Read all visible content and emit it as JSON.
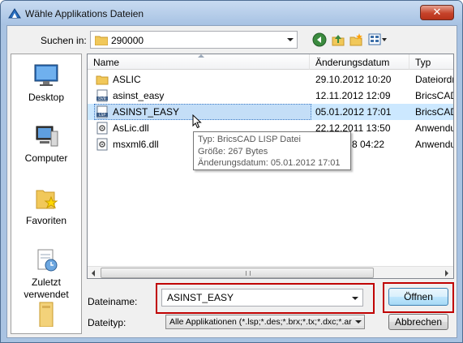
{
  "window": {
    "title": "Wähle Applikations Dateien",
    "close_label": "✕"
  },
  "lookin": {
    "label": "Suchen in:",
    "value": "290000"
  },
  "places": [
    {
      "label": "Desktop",
      "icon": "desktop-icon"
    },
    {
      "label": "Computer",
      "icon": "computer-icon"
    },
    {
      "label": "Favoriten",
      "icon": "favorites-icon"
    },
    {
      "label": "Zuletzt\nverwendet",
      "icon": "recent-icon"
    },
    {
      "label": "",
      "icon": "libraries-icon"
    }
  ],
  "columns": {
    "name": "Name",
    "date": "Änderungsdatum",
    "type": "Typ"
  },
  "files": [
    {
      "name": "ASLIC",
      "date": "29.10.2012 10:20",
      "type": "Dateiordn",
      "icon": "folder-icon"
    },
    {
      "name": "asinst_easy",
      "date": "12.11.2012 12:09",
      "type": "BricsCAD",
      "icon": "dvb-file-icon"
    },
    {
      "name": "ASINST_EASY",
      "date": "05.01.2012 17:01",
      "type": "BricsCAD",
      "icon": "lsp-file-icon",
      "selected": true
    },
    {
      "name": "AsLic.dll",
      "date": "22.12.2011 13:50",
      "type": "Anwendu",
      "icon": "dll-file-icon"
    },
    {
      "name": "msxml6.dll",
      "date": "8 04:22",
      "type": "Anwendu",
      "icon": "dll-file-icon"
    }
  ],
  "tooltip": {
    "line1": "Typ: BricsCAD LISP Datei",
    "line2": "Größe: 267 Bytes",
    "line3": "Änderungsdatum: 05.01.2012 17:01"
  },
  "form": {
    "filename_label": "Dateiname:",
    "filename_value": "ASINST_EASY",
    "filetype_label": "Dateityp:",
    "filetype_value": "Alle Applikationen (*.lsp;*.des;*.brx;*.tx;*.dxc;*.ar",
    "open_label": "Öffnen",
    "cancel_label": "Abbrechen"
  },
  "colors": {
    "selection": "#cce8ff",
    "highlight": "#c00000",
    "titlebar": "#a7c2e3"
  }
}
